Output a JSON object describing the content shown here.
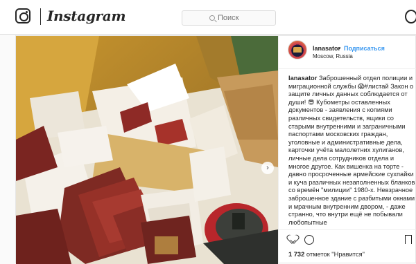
{
  "header": {
    "brand": "Instagram",
    "search_placeholder": "Поиск"
  },
  "post": {
    "username": "lanasator",
    "separator": "•",
    "follow_label": "Подписаться",
    "location": "Moscow, Russia",
    "caption_username": "lanasator",
    "caption_text": "Заброшенный отдел полиции и миграционной службы 😱#листай Закон о защите личных данных соблюдается от души! 😎 Кубометры оставленных документов - заявления с копиями различных свидетельств, ящики со старыми внутренними и заграничными паспортами московских граждан, уголовные и административные дела, карточки учёта малолетних хулиганов, личные дела сотрудников отдела и многое другое. Как вишенка на торте - давно просроченные армейские сухпайки и куча различных незаполненных бланков со времён \"милиции\" 1980-х. Невзрачное заброшенное здание с разбитыми окнами и мрачным внутренним двором, - даже странно, что внутри ещё не побывали любопытные",
    "likes_count": "1 732",
    "likes_label": "отметок \"Нравится\"",
    "next_arrow": "›"
  },
  "colors": {
    "link_blue": "#3897f0",
    "text": "#262626",
    "border": "#dbdbdb"
  },
  "icons": [
    "instagram-glyph-icon",
    "search-icon",
    "profile-icon",
    "next-arrow-icon",
    "heart-icon",
    "comment-icon",
    "bookmark-icon"
  ]
}
